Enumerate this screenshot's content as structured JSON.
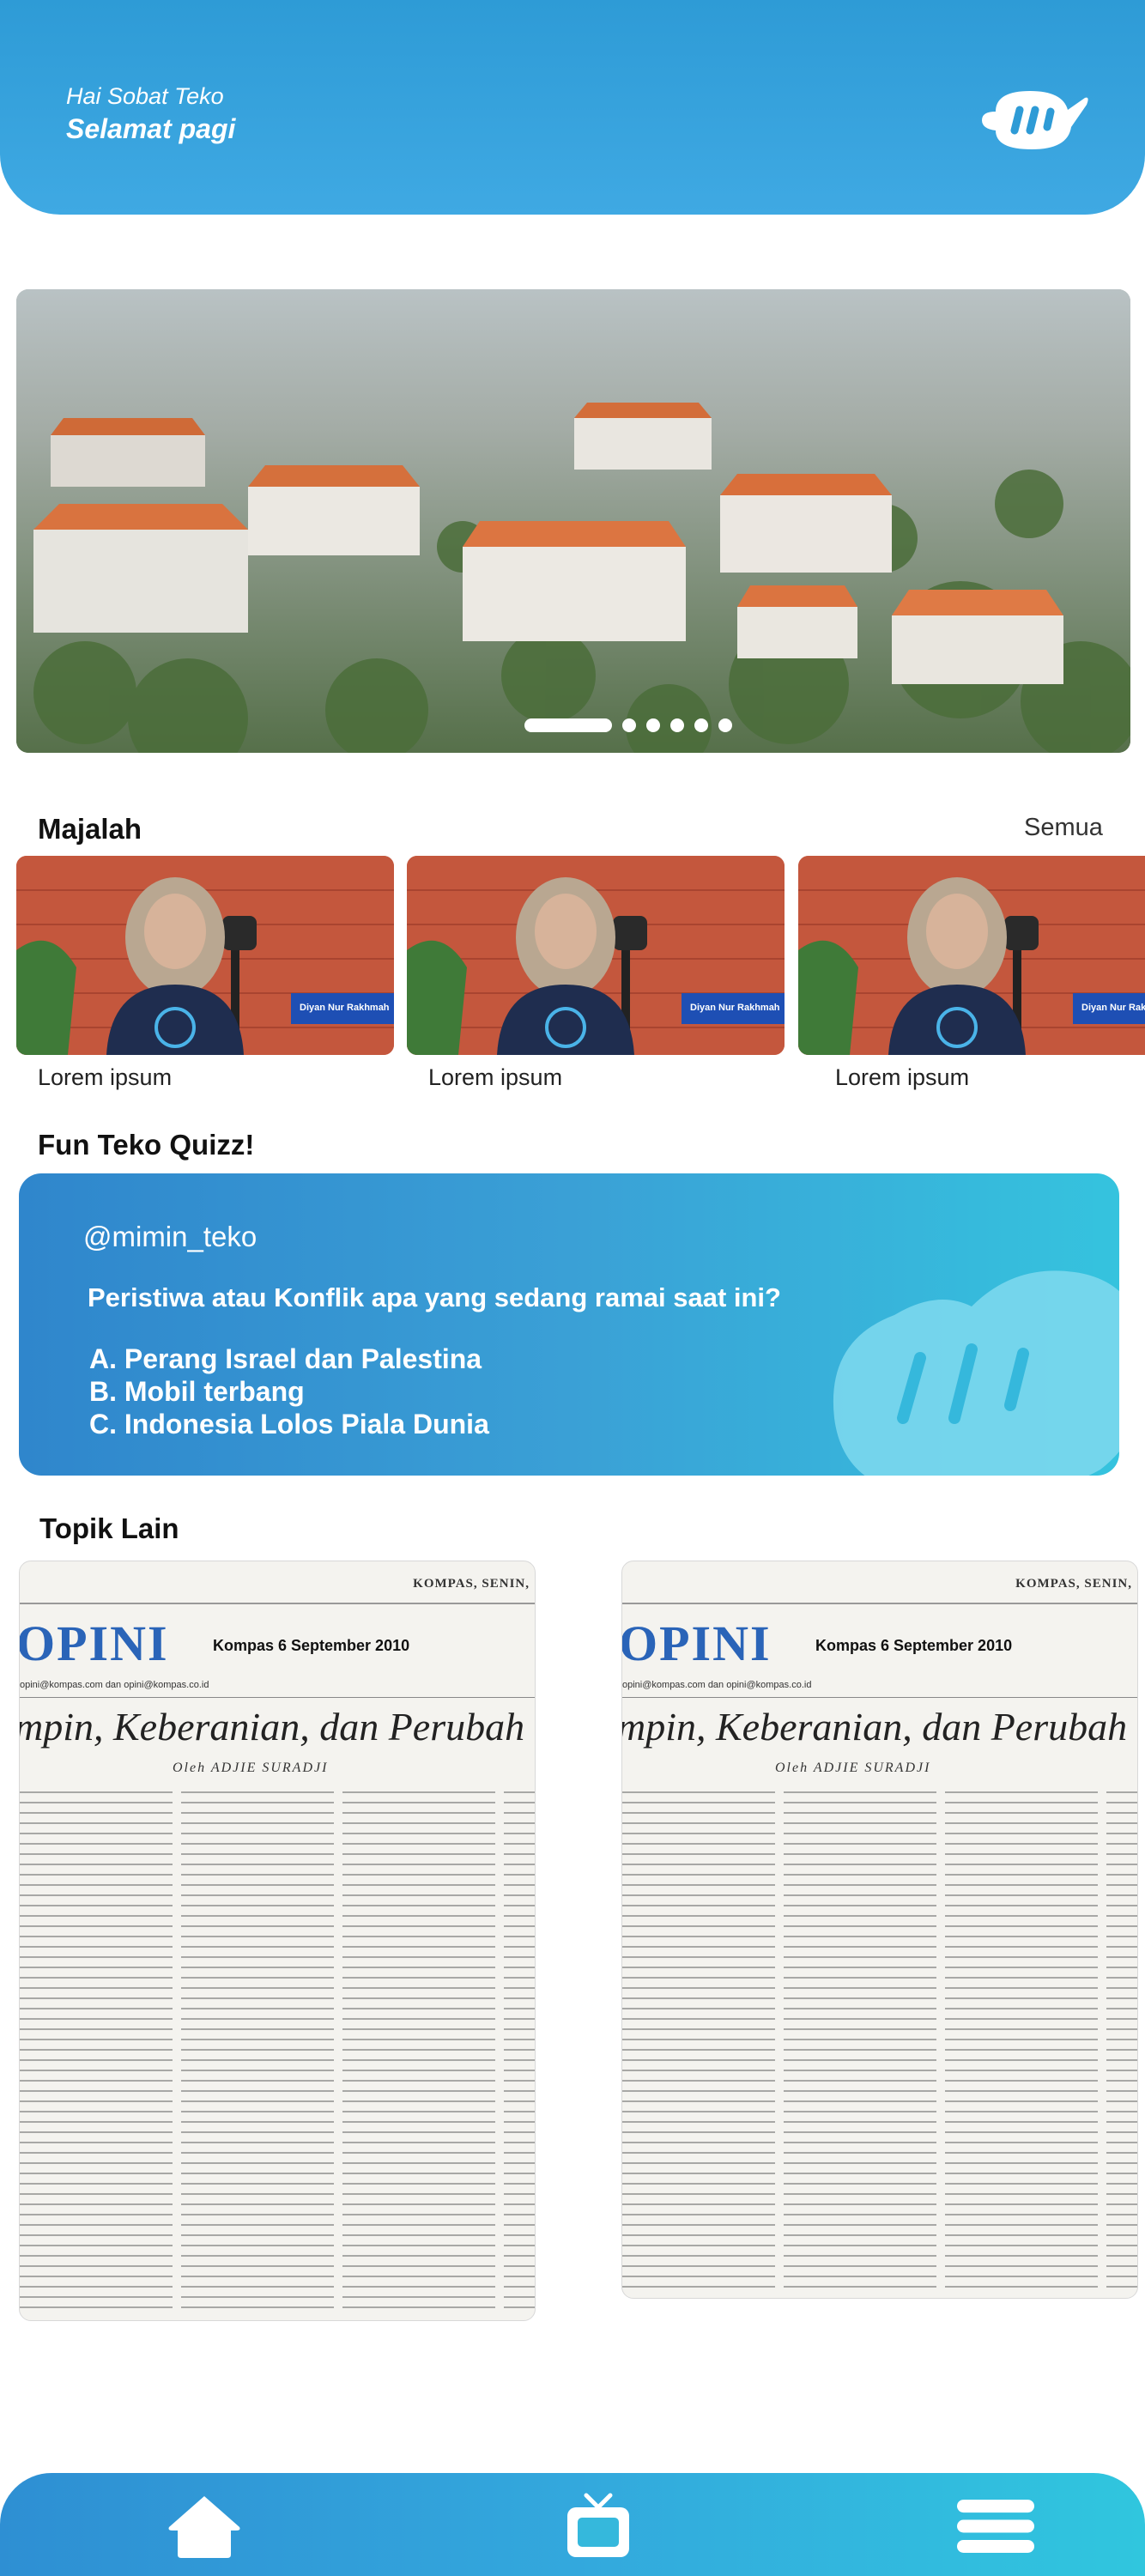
{
  "header": {
    "greeting_line1": "Hai Sobat Teko",
    "greeting_line2": "Selamat pagi",
    "logo_icon": "teko-teapot-logo-icon"
  },
  "banner": {
    "image_description_icon": "campus-aerial-photo",
    "slide_count": 6,
    "active_slide": 1
  },
  "majalah": {
    "title": "Majalah",
    "see_all": "Semua",
    "items": [
      {
        "caption": "Lorem ipsum",
        "name_tag": "Diyan Nur Rakhmah"
      },
      {
        "caption": "Lorem ipsum",
        "name_tag": "Diyan Nur Rakhmah"
      },
      {
        "caption": "Lorem ipsum",
        "name_tag": "Diyan Nur Rakhmah"
      }
    ]
  },
  "quiz": {
    "title": "Fun Teko Quizz!",
    "user": "@mimin_teko",
    "question": "Peristiwa atau Konflik apa yang sedang ramai saat ini?",
    "options": [
      "A. Perang Israel dan Palestina",
      "B. Mobil terbang",
      "C. Indonesia Lolos Piala Dunia"
    ]
  },
  "topik_lain": {
    "title": "Topik Lain",
    "cards": [
      {
        "paper_header": "KOMPAS, SENIN,",
        "section": "OPINI",
        "date": "Kompas 6 September 2010",
        "email": "opini@kompas.com dan opini@kompas.co.id",
        "headline": "mpin, Keberanian, dan Perubah",
        "byline": "Oleh ADJIE SURADJI"
      },
      {
        "paper_header": "KOMPAS, SENIN,",
        "section": "OPINI",
        "date": "Kompas 6 September 2010",
        "email": "opini@kompas.com dan opini@kompas.co.id",
        "headline": "mpin, Keberanian, dan Perubah",
        "byline": "Oleh ADJIE SURADJI"
      }
    ]
  },
  "bottom_nav": {
    "items": [
      {
        "icon": "home-icon"
      },
      {
        "icon": "tv-icon"
      },
      {
        "icon": "menu-icon"
      }
    ]
  },
  "colors": {
    "primary": "#2e9bd6",
    "accent_cyan": "#35c3de",
    "white": "#ffffff"
  }
}
